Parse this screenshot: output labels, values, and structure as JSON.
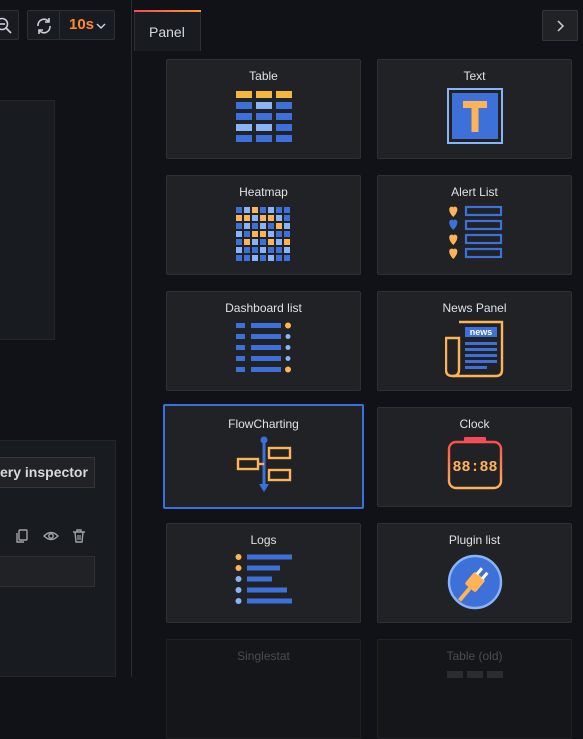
{
  "toolbar": {
    "refresh_interval": "10s"
  },
  "query": {
    "inspector_label": "ery inspector"
  },
  "panel_drawer": {
    "tab_label": "Panel"
  },
  "visualizations": [
    {
      "name": "Table",
      "icon": "table-icon"
    },
    {
      "name": "Text",
      "icon": "text-icon"
    },
    {
      "name": "Heatmap",
      "icon": "heatmap-icon"
    },
    {
      "name": "Alert List",
      "icon": "alert-list-icon"
    },
    {
      "name": "Dashboard list",
      "icon": "dashboard-list-icon"
    },
    {
      "name": "News Panel",
      "icon": "news-icon"
    },
    {
      "name": "FlowCharting",
      "icon": "flowcharting-icon"
    },
    {
      "name": "Clock",
      "icon": "clock-icon"
    },
    {
      "name": "Logs",
      "icon": "logs-icon"
    },
    {
      "name": "Plugin list",
      "icon": "plugin-icon"
    },
    {
      "name": "Singlestat",
      "icon": "singlestat-icon"
    },
    {
      "name": "Table (old)",
      "icon": "table-old-icon"
    }
  ],
  "selected": "FlowCharting",
  "colors": {
    "accent_blue": "#3871dc",
    "accent_orange": "#ff8833",
    "icon_blue": "#3d71d9",
    "icon_yellow": "#ffb357"
  }
}
